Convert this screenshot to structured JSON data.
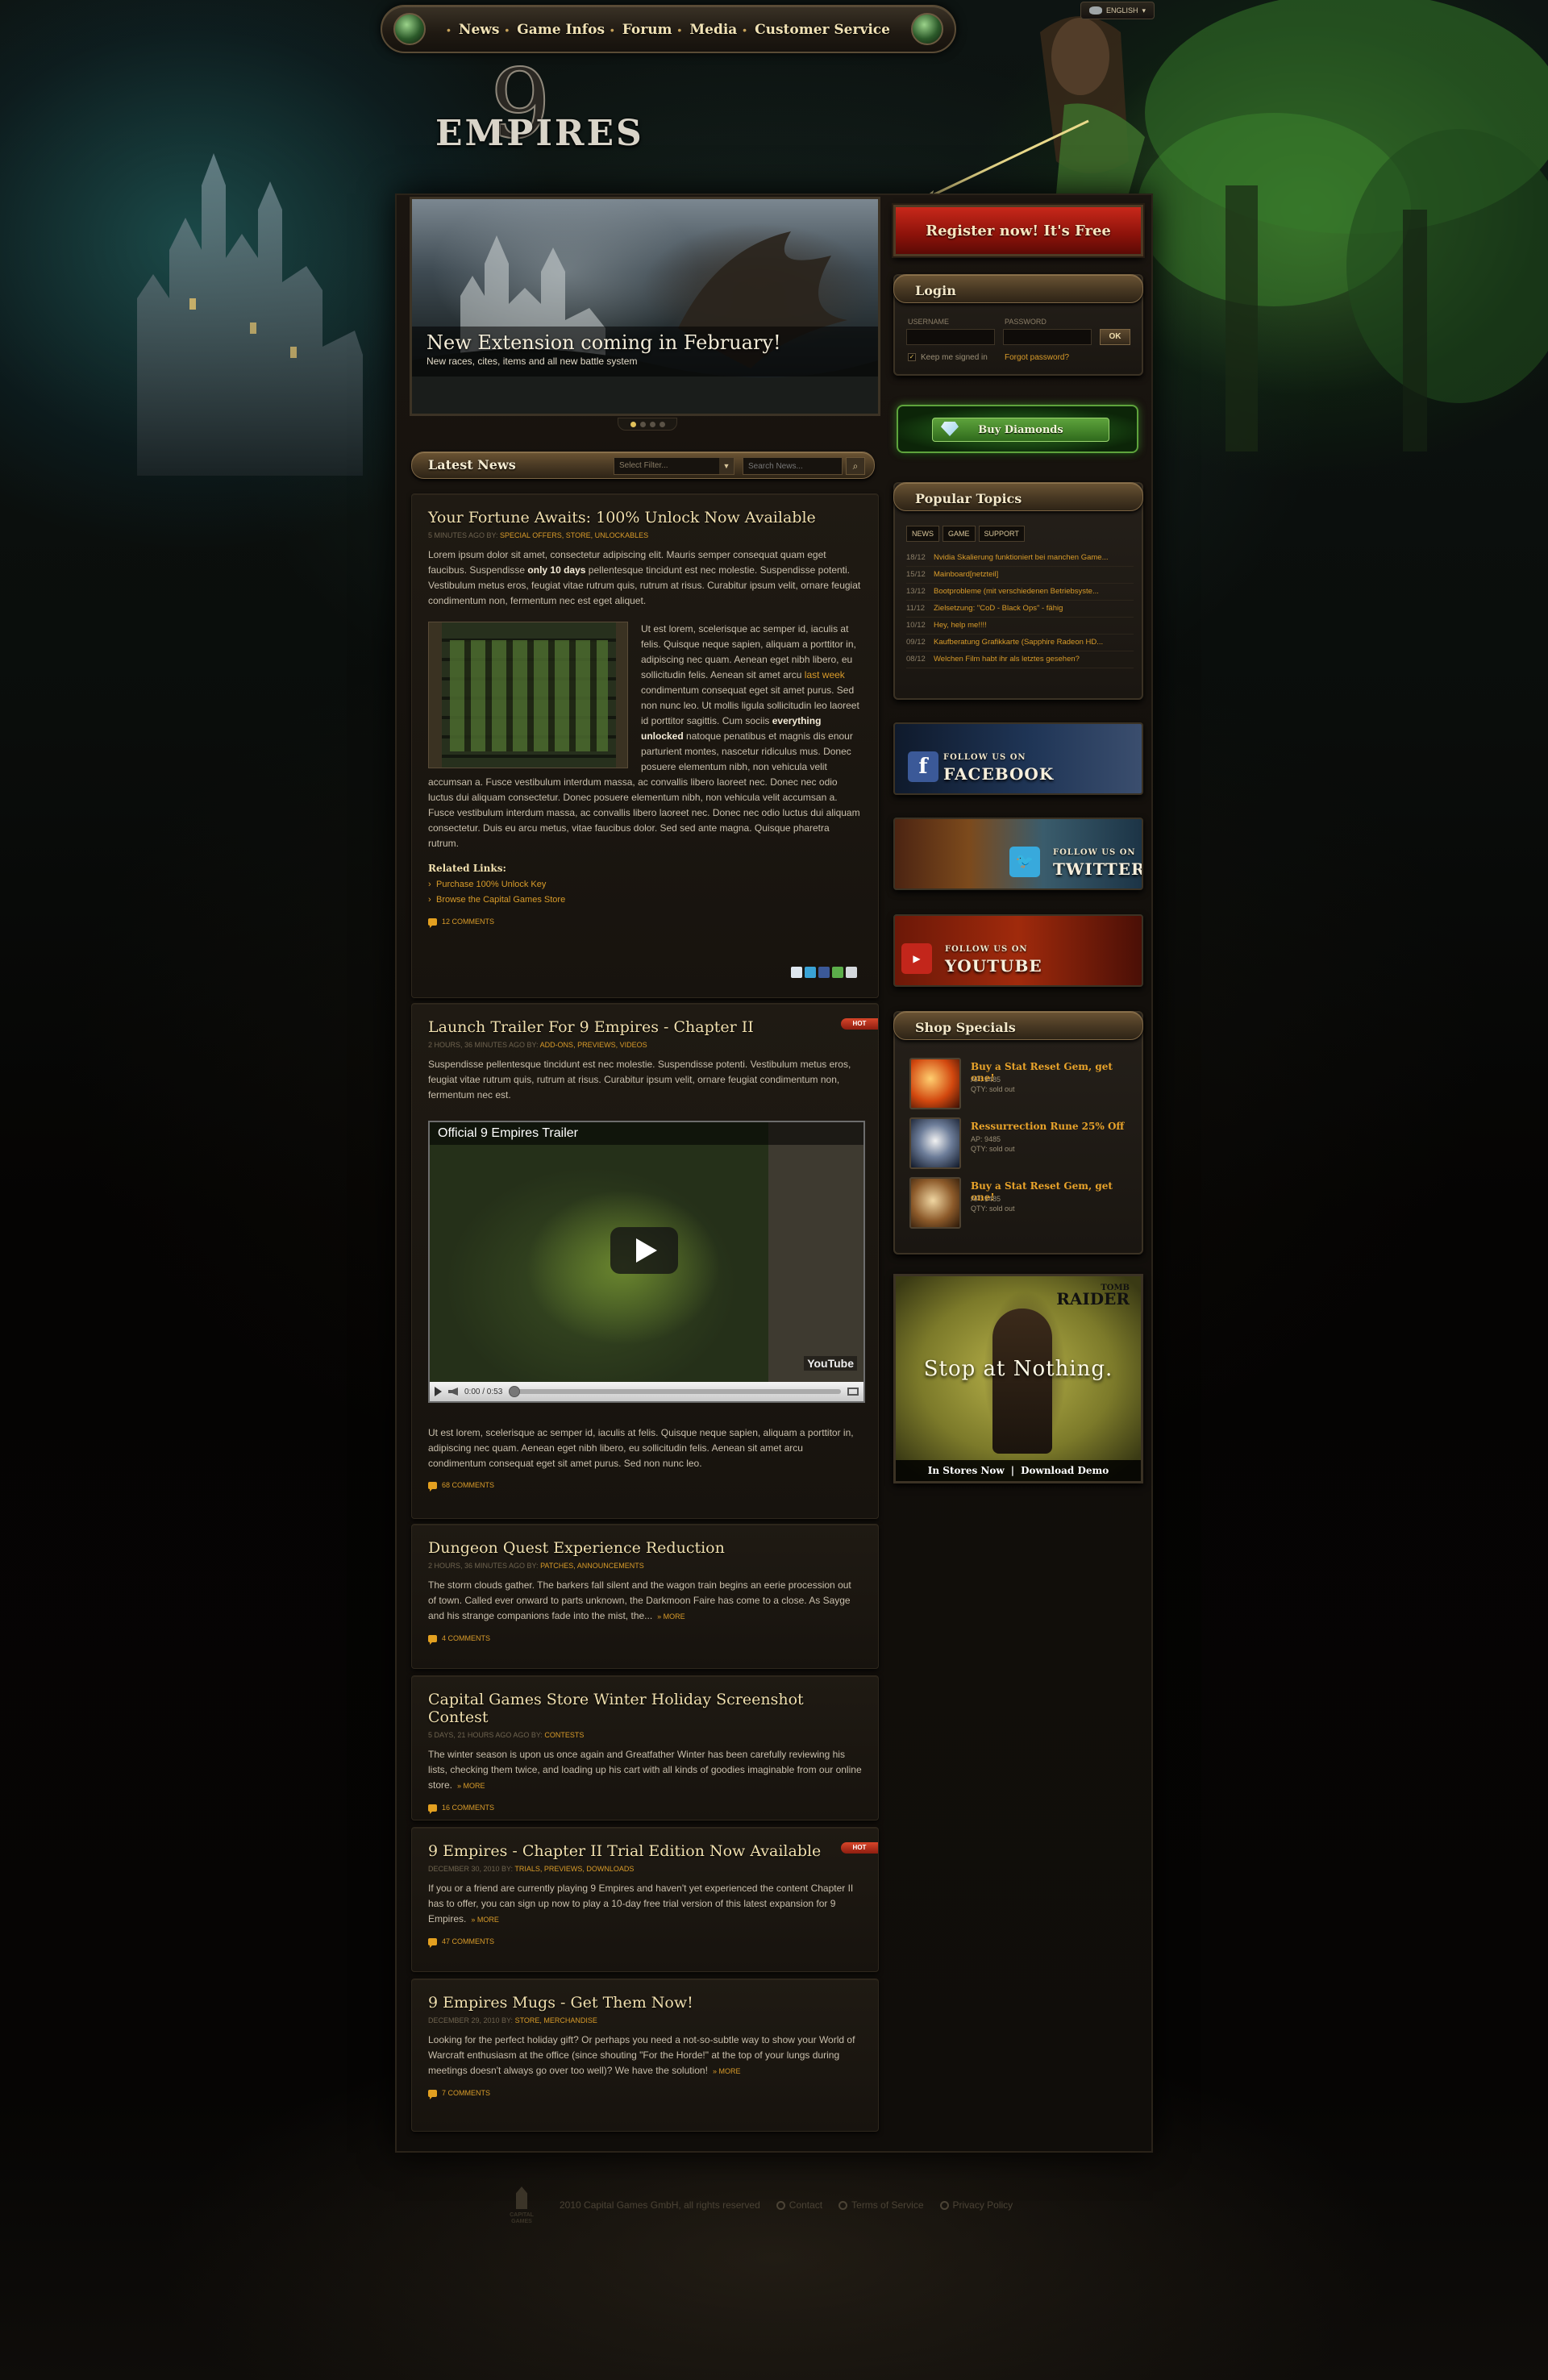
{
  "language": "ENGLISH",
  "nav": [
    "News",
    "Game Infos",
    "Forum",
    "Media",
    "Customer Service"
  ],
  "logo": {
    "numeral": "9",
    "word": "EMPIRES"
  },
  "slider": {
    "title": "New Extension coming in February!",
    "subtitle": "New races, cites, items and all new battle system",
    "slide_count": 4,
    "active_slide": 1
  },
  "latest_news": {
    "title": "Latest News",
    "filter_placeholder": "Select Filter...",
    "search_placeholder": "Search News..."
  },
  "articles": [
    {
      "title": "Your Fortune Awaits: 100% Unlock Now Available",
      "meta": "5 MINUTES AGO BY:",
      "categories": "SPECIAL OFFERS, STORE, UNLOCKABLES",
      "intro_a": "Lorem ipsum dolor sit amet, consectetur adipiscing elit. Mauris semper consequat quam eget faucibus. Suspendisse ",
      "intro_bold": "only 10 days",
      "intro_b": " pellentesque tincidunt est nec molestie. Suspendisse potenti. Vestibulum metus eros, feugiat vitae rutrum quis, rutrum at risus. Curabitur ipsum velit, ornare feugiat condimentum non, fermentum nec est eget aliquet.",
      "side_a": "Ut est lorem, scelerisque ac semper id, iaculis at felis. Quisque neque sapien, aliquam a porttitor in, adipiscing nec quam. Aenean eget nibh libero, eu sollicitudin felis. Aenean sit amet arcu ",
      "side_link": "last week",
      "side_b": " condimentum consequat eget sit amet purus. Sed non nunc leo. Ut mollis ligula sollicitudin leo laoreet id porttitor sagittis. Cum sociis ",
      "side_bold": "everything unlocked",
      "side_c": " natoque penatibus et magnis dis enour parturient montes, nascetur ridiculus mus. Donec posuere elementum nibh, non vehicula velit accumsan a. Fusce vestibulum interdum massa, ac convallis libero laoreet nec. Donec nec odio luctus dui aliquam consectetur. Donec posuere elementum nibh, non vehicula velit accumsan a. Fusce vestibulum interdum massa, ac convallis libero laoreet nec. Donec nec odio luctus dui aliquam consectetur. Duis eu arcu metus, vitae faucibus dolor. Sed sed ante magna. Quisque pharetra rutrum.",
      "related_title": "Related Links:",
      "related": [
        "Purchase 100% Unlock Key",
        "Browse the Capital Games Store"
      ],
      "comments": "12 COMMENTS"
    },
    {
      "title": "Launch Trailer For 9 Empires - Chapter II",
      "meta": "2 HOURS, 36 MINUTES AGO BY:",
      "categories": "ADD-ONS, PREVIEWS, VIDEOS",
      "hot": "HOT",
      "body_a": "Suspendisse pellentesque tincidunt est nec molestie. Suspendisse potenti. Vestibulum metus eros, feugiat vitae rutrum quis, rutrum at risus. Curabitur ipsum velit, ornare feugiat condimentum non, fermentum nec est.",
      "video_title": "Official 9 Empires Trailer",
      "video_time": "0:00 / 0:53",
      "video_brand": "YouTube",
      "body_b": "Ut est lorem, scelerisque ac semper id, iaculis at felis. Quisque neque sapien, aliquam a porttitor in, adipiscing nec quam. Aenean eget nibh libero, eu sollicitudin felis. Aenean sit amet arcu condimentum consequat eget sit amet purus. Sed non nunc leo.",
      "comments": "68 COMMENTS"
    },
    {
      "title": "Dungeon Quest Experience Reduction",
      "meta": "2 HOURS, 36 MINUTES AGO BY:",
      "categories": "PATCHES, ANNOUNCEMENTS",
      "body": "The storm clouds gather. The barkers fall silent and the wagon train begins an eerie procession out of town. Called ever onward to parts unknown, the Darkmoon Faire has come to a close. As Sayge and his strange companions fade into the mist, the...",
      "more": "» MORE",
      "comments": "4 COMMENTS"
    },
    {
      "title": "Capital Games Store Winter Holiday Screenshot Contest",
      "meta": "5 DAYS, 21 HOURS AGO AGO BY:",
      "categories": "CONTESTS",
      "body": "The winter season is upon us once again and Greatfather Winter has been carefully reviewing his lists, checking them twice, and loading up his cart with all kinds of goodies imaginable from our online store.",
      "more": "» MORE",
      "comments": "16 COMMENTS"
    },
    {
      "title": "9 Empires - Chapter II Trial Edition Now Available",
      "meta": "DECEMBER 30, 2010 BY:",
      "categories": "TRIALS, PREVIEWS, DOWNLOADS",
      "hot": "HOT",
      "body": "If you or a friend are currently playing 9 Empires and haven't yet experienced the content Chapter II has to offer, you can sign up now to play a 10-day free trial version of this latest expansion for 9 Empires.",
      "more": "» MORE",
      "comments": "47 COMMENTS"
    },
    {
      "title": "9 Empires Mugs - Get Them Now!",
      "meta": "DECEMBER 29, 2010 BY:",
      "categories": "STORE, MERCHANDISE",
      "body": "Looking for the perfect holiday gift? Or perhaps you need a not-so-subtle way to show your World of Warcraft enthusiasm at the office (since shouting \"For the Horde!\" at the top of your lungs during meetings doesn't always go over too well)? We have the solution!",
      "more": "» MORE",
      "comments": "7 COMMENTS"
    }
  ],
  "sidebar": {
    "register": "Register now! It's Free",
    "login": {
      "title": "Login",
      "username_label": "USERNAME",
      "password_label": "PASSWORD",
      "ok": "OK",
      "keep_signed_in": "Keep me signed in",
      "forgot": "Forgot password?"
    },
    "diamonds": "Buy Diamonds",
    "topics": {
      "title": "Popular Topics",
      "tabs": [
        "NEWS",
        "GAME",
        "SUPPORT"
      ],
      "items": [
        {
          "date": "18/12",
          "title": "Nvidia Skalierung funktioniert bei manchen Game..."
        },
        {
          "date": "15/12",
          "title": "Mainboard[netzteil]"
        },
        {
          "date": "13/12",
          "title": "Bootprobleme (mit verschiedenen Betriebsyste..."
        },
        {
          "date": "11/12",
          "title": "Zielsetzung: \"CoD - Black Ops\" - fähig"
        },
        {
          "date": "10/12",
          "title": "Hey, help me!!!!"
        },
        {
          "date": "09/12",
          "title": "Kaufberatung Grafikkarte (Sapphire Radeon HD..."
        },
        {
          "date": "08/12",
          "title": "Welchen Film habt ihr als letztes gesehen?"
        }
      ]
    },
    "social": {
      "follow": "FOLLOW US ON",
      "facebook": "FACEBOOK",
      "twitter": "TWITTER",
      "youtube": "YOUTUBE"
    },
    "shop": {
      "title": "Shop Specials",
      "items": [
        {
          "name": "Buy a Stat Reset Gem, get one!",
          "ap": "AP:   9485",
          "qty": "QTY: sold out"
        },
        {
          "name": "Ressurrection Rune 25% Off",
          "ap": "AP:   9485",
          "qty": "QTY: sold out"
        },
        {
          "name": "Buy a Stat Reset Gem, get one!",
          "ap": "AP:   9485",
          "qty": "QTY: sold out"
        }
      ]
    },
    "ad": {
      "brand_small": "TOMB",
      "brand": "RAIDER",
      "headline": "Stop at Nothing.",
      "cta_left": "In Stores Now",
      "cta_right": "Download Demo"
    }
  },
  "footer": {
    "logo_text": "CAPITAL GAMES",
    "copyright": "2010 Capital Games GmbH, all rights reserved",
    "links": [
      "Contact",
      "Terms of Service",
      "Privacy Policy"
    ]
  },
  "colors": {
    "accent": "#d89b2a",
    "heading": "#f0dfae",
    "register": "#b01d10",
    "diamond": "#5ea33c"
  }
}
